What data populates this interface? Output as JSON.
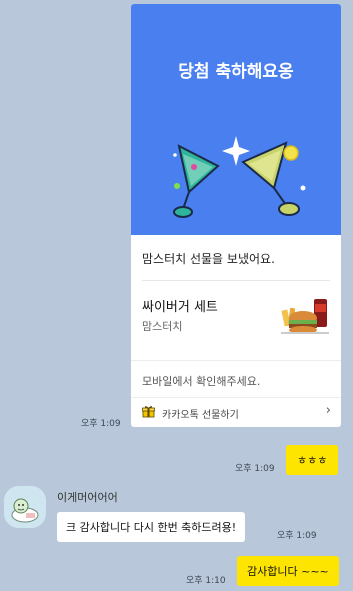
{
  "gift": {
    "banner_title": "당첨 축하해요옹",
    "sent_text": "맘스터치 선물을 보냈어요.",
    "product_name": "싸이버거 세트",
    "brand": "맘스터치",
    "mobile_note": "모바일에서 확인해주세요.",
    "link_label": "카카오톡 선물하기",
    "link_icon": "gift-box-icon",
    "chevron_icon": "chevron-right-icon",
    "time": "오후 1:09"
  },
  "messages": [
    {
      "side": "me",
      "text": "ㅎㅎㅎ",
      "time": "오후 1:09"
    },
    {
      "side": "other",
      "sender": "이게머어어어",
      "text": "크 감사합니다 다시 한번 축하드려용!",
      "time": "오후 1:09"
    },
    {
      "side": "me",
      "text": "감사합니다 ~~~",
      "time": "오후 1:10"
    }
  ],
  "colors": {
    "chat_background": "#b8c8da",
    "my_bubble": "#fee500",
    "other_bubble": "#ffffff",
    "gift_banner": "#4a7ff0"
  }
}
